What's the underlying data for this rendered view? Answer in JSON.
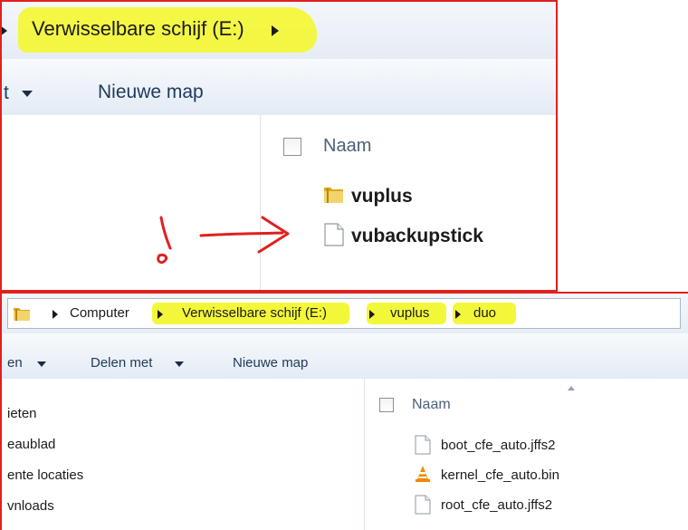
{
  "window1": {
    "breadcrumb": {
      "path": "Verwisselbare schijf (E:)"
    },
    "toolbar": {
      "partial_label": "t",
      "new_folder": "Nieuwe map"
    },
    "list": {
      "column_name": "Naam",
      "items": [
        {
          "name": "vuplus",
          "icon": "folder-icon"
        },
        {
          "name": "vubackupstick",
          "icon": "file-icon"
        }
      ]
    }
  },
  "window2": {
    "breadcrumb": [
      {
        "label": "Computer",
        "highlight": false
      },
      {
        "label": "Verwisselbare schijf",
        "suffix": " (E:)",
        "highlight": true
      },
      {
        "label": "vuplus",
        "highlight": true
      },
      {
        "label": "duo",
        "highlight": true
      }
    ],
    "toolbar": {
      "partial_label": "en",
      "share": "Delen met",
      "new_folder": "Nieuwe map"
    },
    "nav": {
      "items": [
        "ieten",
        "eaublad",
        "ente locaties",
        "vnloads"
      ]
    },
    "list": {
      "column_name": "Naam",
      "items": [
        {
          "name": "boot_cfe_auto.jffs2",
          "icon": "file-icon"
        },
        {
          "name": "kernel_cfe_auto.bin",
          "icon": "vlc-cone-icon"
        },
        {
          "name": "root_cfe_auto.jffs2",
          "icon": "file-icon"
        }
      ]
    }
  },
  "colors": {
    "highlight": "#f3f73a",
    "annotation_red": "#e02020",
    "text_blue": "#1e395b",
    "folder_yellow": "#e8c14a",
    "vlc_orange": "#f08a00"
  }
}
